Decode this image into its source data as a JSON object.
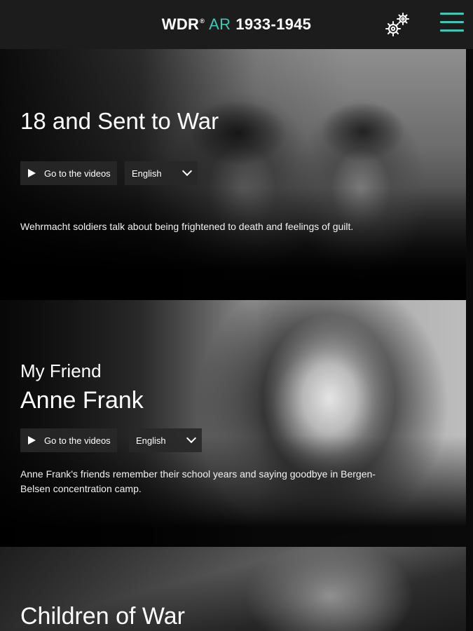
{
  "header": {
    "logo_wdr": "WDR",
    "logo_reg": "®",
    "logo_ar": "AR",
    "logo_years": "1933-1945",
    "settings_icon": "gears-icon",
    "menu_icon": "hamburger-menu-icon",
    "accent_color": "#3fc6b5"
  },
  "stories": [
    {
      "title": "18 and Sent to War",
      "videos_label": "Go to the videos",
      "language": "English",
      "description": "Wehrmacht soldiers talk about being frightened to death and feelings of guilt."
    },
    {
      "title_line1": "My Friend",
      "title_line2": "Anne Frank",
      "videos_label": "Go to the videos",
      "language": "English",
      "description": "Anne Frank's friends remember their school years and saying goodbye in Bergen-Belsen concentration camp."
    },
    {
      "title": "Children of War"
    }
  ]
}
